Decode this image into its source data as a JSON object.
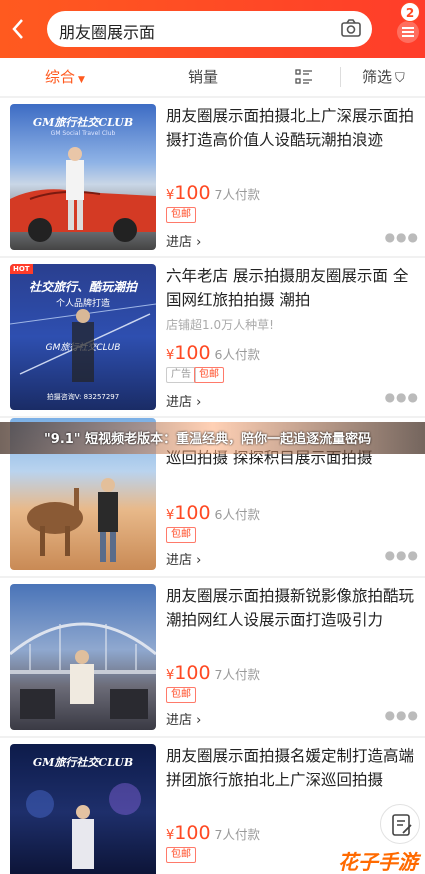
{
  "search": {
    "value": "朋友圈展示面"
  },
  "header": {
    "badge": "2"
  },
  "filters": {
    "comprehensive": "综合",
    "sales": "销量",
    "filter": "筛选"
  },
  "banner": {
    "text": "\"9.1\" 短视频老版本：重温经典，陪你一起追逐流量密码"
  },
  "watermark": "花子手游",
  "products": [
    {
      "title": "朋友圈展示面拍摄北上广深展示面拍摄打造高价值人设酷玩潮拍浪迹",
      "thumb_title": "GM旅行社交CLUB",
      "thumb_sub": "GM Social Travel Club",
      "hint": "",
      "price": "100",
      "currency": "¥",
      "sales": "7人付款",
      "tags": [
        "包邮"
      ],
      "shop": "进店"
    },
    {
      "title": "六年老店 展示拍摄朋友圈展示面 全国网红旅拍拍摄 潮拍",
      "thumb_title": "社交旅行、酷玩潮拍",
      "thumb_sub": "个人品牌打造",
      "thumb_badge": "HOT",
      "thumb_mid": "GM旅行社交CLUB",
      "thumb_contact": "拍摄咨询V: 83257297",
      "hint": "店铺超1.0万人种草!",
      "price": "100",
      "currency": "¥",
      "sales": "6人付款",
      "tags": [
        "广告",
        "包邮"
      ],
      "shop": "进店"
    },
    {
      "title": "巡回拍摄 探探积目展示面拍摄",
      "hint": "",
      "price": "100",
      "currency": "¥",
      "sales": "6人付款",
      "tags": [
        "包邮"
      ],
      "shop": "进店"
    },
    {
      "title": "朋友圈展示面拍摄新锐影像旅拍酷玩潮拍网红人设展示面打造吸引力",
      "hint": "",
      "price": "100",
      "currency": "¥",
      "sales": "7人付款",
      "tags": [
        "包邮"
      ],
      "shop": "进店"
    },
    {
      "title": "朋友圈展示面拍摄名媛定制打造高端拼团旅行旅拍北上广深巡回拍摄",
      "thumb_title": "GM旅行社交CLUB",
      "hint": "",
      "price": "100",
      "currency": "¥",
      "sales": "7人付款",
      "tags": [
        "包邮"
      ],
      "shop": "进店"
    }
  ]
}
